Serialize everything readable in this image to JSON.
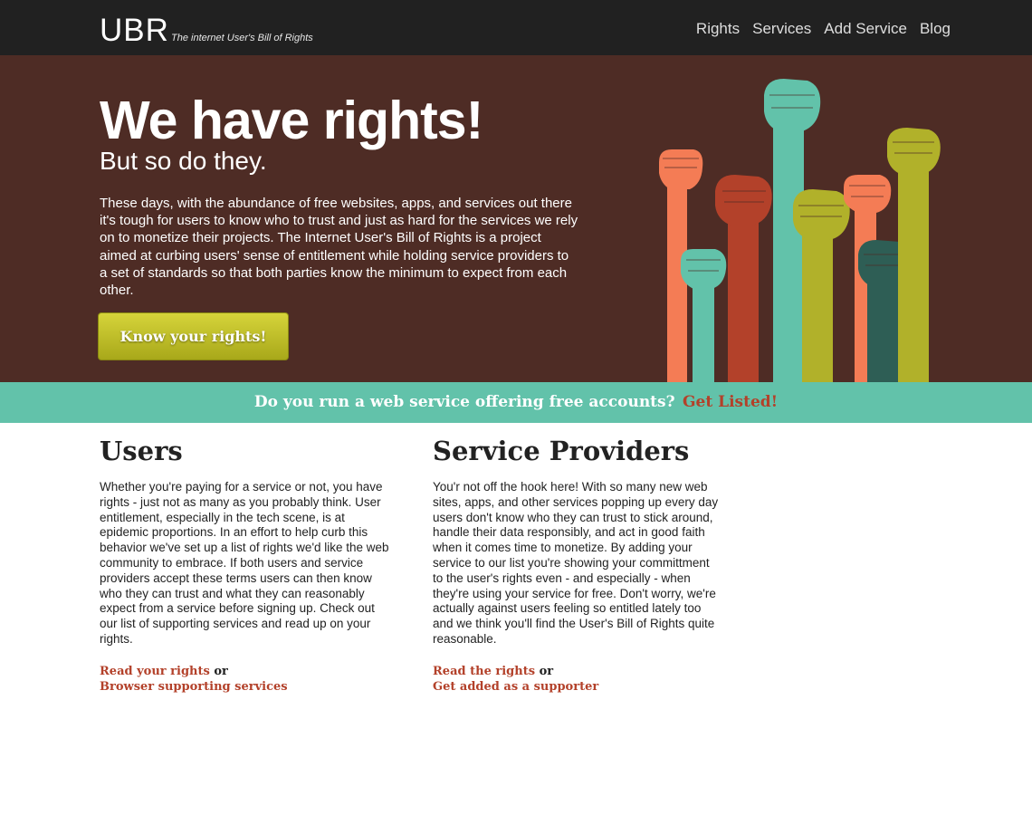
{
  "header": {
    "logo": "UBR",
    "tagline": "The internet User's Bill of Rights",
    "nav": [
      "Rights",
      "Services",
      "Add Service",
      "Blog"
    ]
  },
  "hero": {
    "title": "We have rights!",
    "subtitle": "But so do they.",
    "body": "These days, with the abundance of free websites, apps, and services out there it's tough for users to know who to trust and just as hard for the services we rely on to monetize their projects. The Internet User's Bill of Rights is a project aimed at curbing users' sense of entitlement while holding service providers to a set of standards so that both parties know the minimum to expect from each other.",
    "button": "Know your rights!"
  },
  "banner": {
    "question": "Do you run a web service offering free accounts?",
    "link": "Get Listed!"
  },
  "users": {
    "heading": "Users",
    "body": "Whether you're paying for a service or not, you have rights - just not as many as you probably think. User entitlement, especially in the tech scene, is at epidemic proportions. In an effort to help curb this behavior we've set up a list of rights we'd like the web community to embrace. If both users and service providers accept these terms users can then know who they can trust and what they can reasonably expect from a service before signing up. Check out our list of supporting services and read up on your rights.",
    "link1": "Read your rights",
    "or": "or",
    "link2": "Browser supporting services"
  },
  "providers": {
    "heading": "Service Providers",
    "body": "You'r not off the hook here! With so many new web sites, apps, and other services popping up every day users don't know who they can trust to stick around, handle their data responsibly, and act in good faith when it comes time to monetize. By adding your service to our list you're showing your committment to the user's rights even - and especially - when they're using your service for free. Don't worry, we're actually against users feeling so entitled lately too and we think you'll find the User's Bill of Rights quite reasonable.",
    "link1": "Read the rights",
    "or": "or",
    "link2": "Get added as a supporter"
  },
  "colors": {
    "topbar": "#212121",
    "hero_bg": "#4e2c25",
    "banner_bg": "#62c2aa",
    "accent_link": "#b3412a",
    "button": "#c4c22e",
    "fist_orange": "#f47c55",
    "fist_red": "#b3412a",
    "fist_teal": "#62c2aa",
    "fist_olive": "#b1b12a",
    "fist_dark": "#2e5e55"
  }
}
